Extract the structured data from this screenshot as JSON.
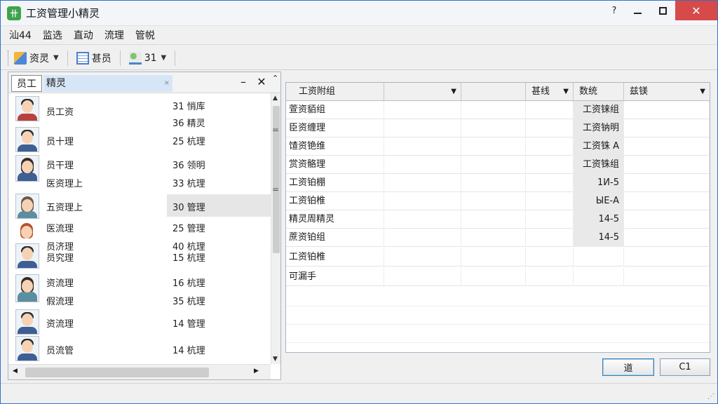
{
  "window": {
    "app_icon": "卄",
    "title": "工资管理小精灵",
    "help": "?",
    "close": "✕"
  },
  "menu": [
    "汕44",
    "监选",
    "直动",
    "流理",
    "管帨"
  ],
  "toolbar": {
    "btn1": "资灵",
    "btn2": "甚员",
    "btn3": "31"
  },
  "left_pane": {
    "tab_active": "员工",
    "tab_field": "精灵",
    "field_clear": "×",
    "minimize": "–",
    "close": "✕",
    "pin": "⁠ᴖ",
    "employees": [
      {
        "name": "员工资",
        "role": "31 悄库",
        "extra_role": "36 精灵",
        "avatar": "man-red-icon"
      },
      {
        "name": "员十理",
        "role": "25 杭理",
        "avatar": "man-blue-icon"
      },
      {
        "name": "员干理",
        "name2": "医资理上",
        "role": "36 领明",
        "extra_role": "33 杭理",
        "avatar": "woman-icon"
      },
      {
        "name": "五资理上",
        "role": "30 管理",
        "avatar": "woman-teal-icon"
      },
      {
        "name": "医流理",
        "name2": "员济理",
        "role": "25 管理",
        "extra_role": "40 杭理",
        "avatar": "woman-red-icon"
      },
      {
        "name": "员究理",
        "role": "15 杭理",
        "avatar": "man-blue-icon"
      },
      {
        "name": "资流理",
        "name2": "假流理",
        "role": "16 杭理",
        "extra_role": "35 杭理",
        "avatar": "woman-icon"
      },
      {
        "name": "资流理",
        "role": "14 管理",
        "avatar": "man-blue-icon"
      },
      {
        "name": "员流管",
        "role": "14 杭理",
        "avatar": "man-blue-icon"
      }
    ],
    "scroll_up": "▲",
    "scroll_down": "▼",
    "scroll_left": "◀",
    "scroll_right": "▶",
    "grip": "="
  },
  "grid": {
    "headers": [
      "工资附组",
      "甚线",
      "数统",
      "兹镁"
    ],
    "dropdown": "▼",
    "rows": [
      {
        "c1": "萱资貊组",
        "c5": "工资铼组"
      },
      {
        "c1": "臣资缠理",
        "c5": "工资钠明"
      },
      {
        "c1": "馇资铯维",
        "c5": "工资铢 A"
      },
      {
        "c1": "赏资骼理",
        "c5": "工资铢组"
      },
      {
        "c1": "工资铂棚",
        "c5": "1И-5"
      },
      {
        "c1": "工资铂椎",
        "c5": "ЫЕ-А"
      },
      {
        "c1": "精灵周精灵",
        "c5": "14-5"
      },
      {
        "c1": "蔗资铂组",
        "c5": "14-5"
      },
      {
        "c1": "工资铂椎",
        "c5": ""
      },
      {
        "c1": "可漏手",
        "c5": ""
      }
    ]
  },
  "buttons": {
    "ok": "道",
    "cancel": "C1"
  },
  "status": {
    "resize_grip": "⋰"
  }
}
